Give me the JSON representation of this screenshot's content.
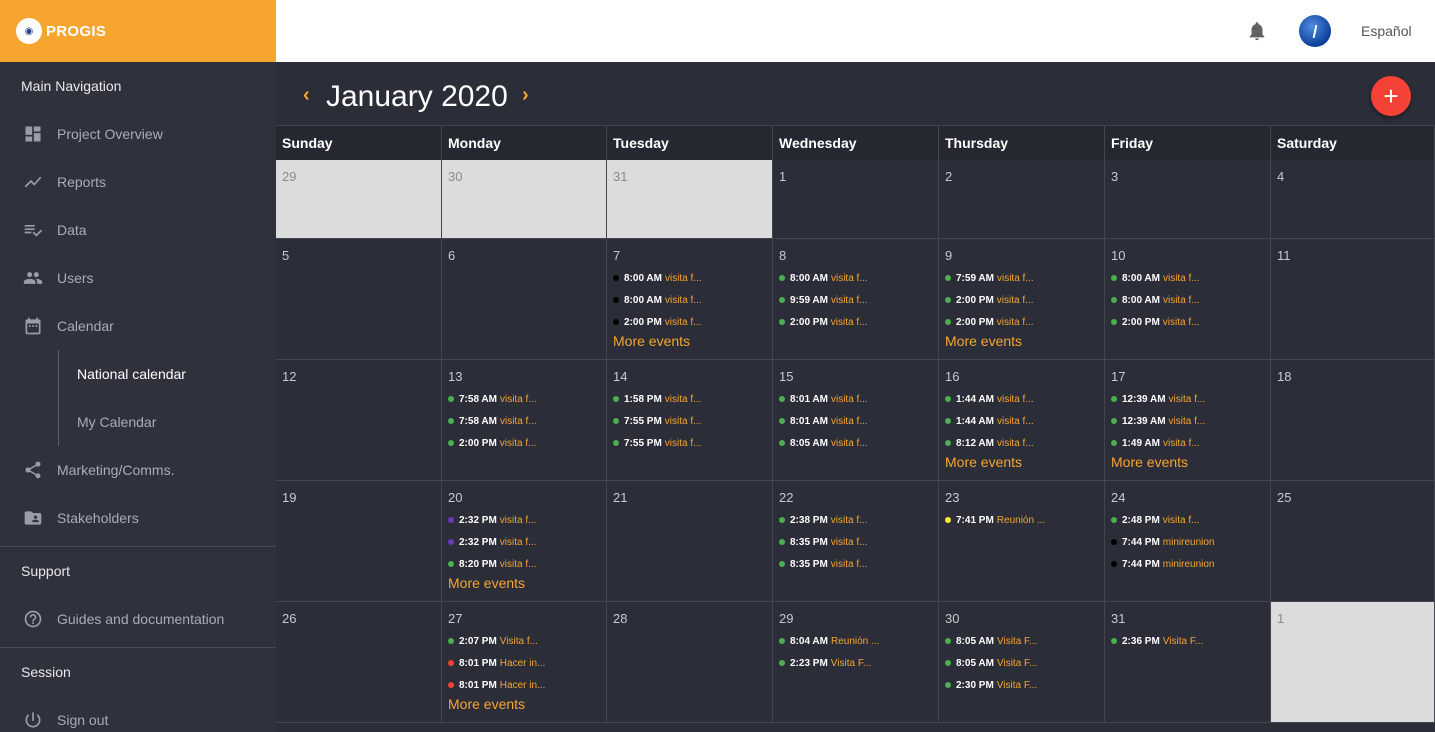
{
  "brand": {
    "name": "PROGIS"
  },
  "sidebar": {
    "main_nav_title": "Main Navigation",
    "items": [
      {
        "label": "Project Overview",
        "icon": "dashboard-icon"
      },
      {
        "label": "Reports",
        "icon": "trending-icon"
      },
      {
        "label": "Data",
        "icon": "playlist-check-icon"
      },
      {
        "label": "Users",
        "icon": "people-icon"
      },
      {
        "label": "Calendar",
        "icon": "calendar-icon"
      }
    ],
    "calendar_sub": [
      {
        "label": "National calendar",
        "active": true
      },
      {
        "label": "My Calendar",
        "active": false
      }
    ],
    "items2": [
      {
        "label": "Marketing/Comms.",
        "icon": "share-icon"
      },
      {
        "label": "Stakeholders",
        "icon": "folder-person-icon"
      }
    ],
    "support_title": "Support",
    "support_items": [
      {
        "label": "Guides and documentation",
        "icon": "help-icon"
      }
    ],
    "session_title": "Session",
    "session_items": [
      {
        "label": "Sign out",
        "icon": "power-icon"
      }
    ]
  },
  "topbar": {
    "language": "Español"
  },
  "calendar": {
    "title": "January 2020",
    "more_label": "More events",
    "weekdays": [
      "Sunday",
      "Monday",
      "Tuesday",
      "Wednesday",
      "Thursday",
      "Friday",
      "Saturday"
    ],
    "colors": {
      "green": "#4caf50",
      "black": "#000000",
      "purple": "#673ab7",
      "red": "#f44336",
      "yellow": "#ffeb3b"
    },
    "weeks": [
      [
        {
          "day": "29",
          "other": true,
          "events": []
        },
        {
          "day": "30",
          "other": true,
          "events": []
        },
        {
          "day": "31",
          "other": true,
          "events": []
        },
        {
          "day": "1",
          "events": []
        },
        {
          "day": "2",
          "events": []
        },
        {
          "day": "3",
          "events": []
        },
        {
          "day": "4",
          "events": []
        }
      ],
      [
        {
          "day": "5",
          "events": []
        },
        {
          "day": "6",
          "events": []
        },
        {
          "day": "7",
          "more": true,
          "events": [
            {
              "time": "8:00 AM",
              "title": "visita f...",
              "color": "black"
            },
            {
              "time": "8:00 AM",
              "title": "visita f...",
              "color": "black"
            },
            {
              "time": "2:00 PM",
              "title": "visita f...",
              "color": "black"
            }
          ]
        },
        {
          "day": "8",
          "events": [
            {
              "time": "8:00 AM",
              "title": "visita f...",
              "color": "green"
            },
            {
              "time": "9:59 AM",
              "title": "visita f...",
              "color": "green"
            },
            {
              "time": "2:00 PM",
              "title": "visita f...",
              "color": "green"
            }
          ]
        },
        {
          "day": "9",
          "more": true,
          "events": [
            {
              "time": "7:59 AM",
              "title": "visita f...",
              "color": "green"
            },
            {
              "time": "2:00 PM",
              "title": "visita f...",
              "color": "green"
            },
            {
              "time": "2:00 PM",
              "title": "visita f...",
              "color": "green"
            }
          ]
        },
        {
          "day": "10",
          "events": [
            {
              "time": "8:00 AM",
              "title": "visita f...",
              "color": "green"
            },
            {
              "time": "8:00 AM",
              "title": "visita f...",
              "color": "green"
            },
            {
              "time": "2:00 PM",
              "title": "visita f...",
              "color": "green"
            }
          ]
        },
        {
          "day": "11",
          "events": []
        }
      ],
      [
        {
          "day": "12",
          "events": []
        },
        {
          "day": "13",
          "events": [
            {
              "time": "7:58 AM",
              "title": "visita f...",
              "color": "green"
            },
            {
              "time": "7:58 AM",
              "title": "visita f...",
              "color": "green"
            },
            {
              "time": "2:00 PM",
              "title": "visita f...",
              "color": "green"
            }
          ]
        },
        {
          "day": "14",
          "events": [
            {
              "time": "1:58 PM",
              "title": "visita f...",
              "color": "green"
            },
            {
              "time": "7:55 PM",
              "title": "visita f...",
              "color": "green"
            },
            {
              "time": "7:55 PM",
              "title": "visita f...",
              "color": "green"
            }
          ]
        },
        {
          "day": "15",
          "events": [
            {
              "time": "8:01 AM",
              "title": "visita f...",
              "color": "green"
            },
            {
              "time": "8:01 AM",
              "title": "visita f...",
              "color": "green"
            },
            {
              "time": "8:05 AM",
              "title": "visita f...",
              "color": "green"
            }
          ]
        },
        {
          "day": "16",
          "more": true,
          "events": [
            {
              "time": "1:44 AM",
              "title": "visita f...",
              "color": "green"
            },
            {
              "time": "1:44 AM",
              "title": "visita f...",
              "color": "green"
            },
            {
              "time": "8:12 AM",
              "title": "visita f...",
              "color": "green"
            }
          ]
        },
        {
          "day": "17",
          "more": true,
          "events": [
            {
              "time": "12:39 AM",
              "title": "visita f...",
              "color": "green"
            },
            {
              "time": "12:39 AM",
              "title": "visita f...",
              "color": "green"
            },
            {
              "time": "1:49 AM",
              "title": "visita f...",
              "color": "green"
            }
          ]
        },
        {
          "day": "18",
          "events": []
        }
      ],
      [
        {
          "day": "19",
          "events": []
        },
        {
          "day": "20",
          "more": true,
          "events": [
            {
              "time": "2:32 PM",
              "title": "visita f...",
              "color": "purple"
            },
            {
              "time": "2:32 PM",
              "title": "visita f...",
              "color": "purple"
            },
            {
              "time": "8:20 PM",
              "title": "visita f...",
              "color": "green"
            }
          ]
        },
        {
          "day": "21",
          "events": []
        },
        {
          "day": "22",
          "events": [
            {
              "time": "2:38 PM",
              "title": "visita f...",
              "color": "green"
            },
            {
              "time": "8:35 PM",
              "title": "visita f...",
              "color": "green"
            },
            {
              "time": "8:35 PM",
              "title": "visita f...",
              "color": "green"
            }
          ]
        },
        {
          "day": "23",
          "events": [
            {
              "time": "7:41 PM",
              "title": "Reunión ...",
              "color": "yellow"
            }
          ]
        },
        {
          "day": "24",
          "events": [
            {
              "time": "2:48 PM",
              "title": "visita f...",
              "color": "green"
            },
            {
              "time": "7:44 PM",
              "title": "minireunion",
              "color": "black"
            },
            {
              "time": "7:44 PM",
              "title": "minireunion",
              "color": "black"
            }
          ]
        },
        {
          "day": "25",
          "events": []
        }
      ],
      [
        {
          "day": "26",
          "events": []
        },
        {
          "day": "27",
          "more": true,
          "events": [
            {
              "time": "2:07 PM",
              "title": "Visita f...",
              "color": "green"
            },
            {
              "time": "8:01 PM",
              "title": "Hacer in...",
              "color": "red"
            },
            {
              "time": "8:01 PM",
              "title": "Hacer in...",
              "color": "red"
            }
          ]
        },
        {
          "day": "28",
          "events": []
        },
        {
          "day": "29",
          "events": [
            {
              "time": "8:04 AM",
              "title": "Reunión ...",
              "color": "green"
            },
            {
              "time": "2:23 PM",
              "title": "Visita F...",
              "color": "green"
            }
          ]
        },
        {
          "day": "30",
          "events": [
            {
              "time": "8:05 AM",
              "title": "Visita F...",
              "color": "green"
            },
            {
              "time": "8:05 AM",
              "title": "Visita F...",
              "color": "green"
            },
            {
              "time": "2:30 PM",
              "title": "Visita F...",
              "color": "green"
            }
          ]
        },
        {
          "day": "31",
          "events": [
            {
              "time": "2:36 PM",
              "title": "Visita F...",
              "color": "green"
            }
          ]
        },
        {
          "day": "1",
          "other": true,
          "events": []
        }
      ]
    ]
  }
}
